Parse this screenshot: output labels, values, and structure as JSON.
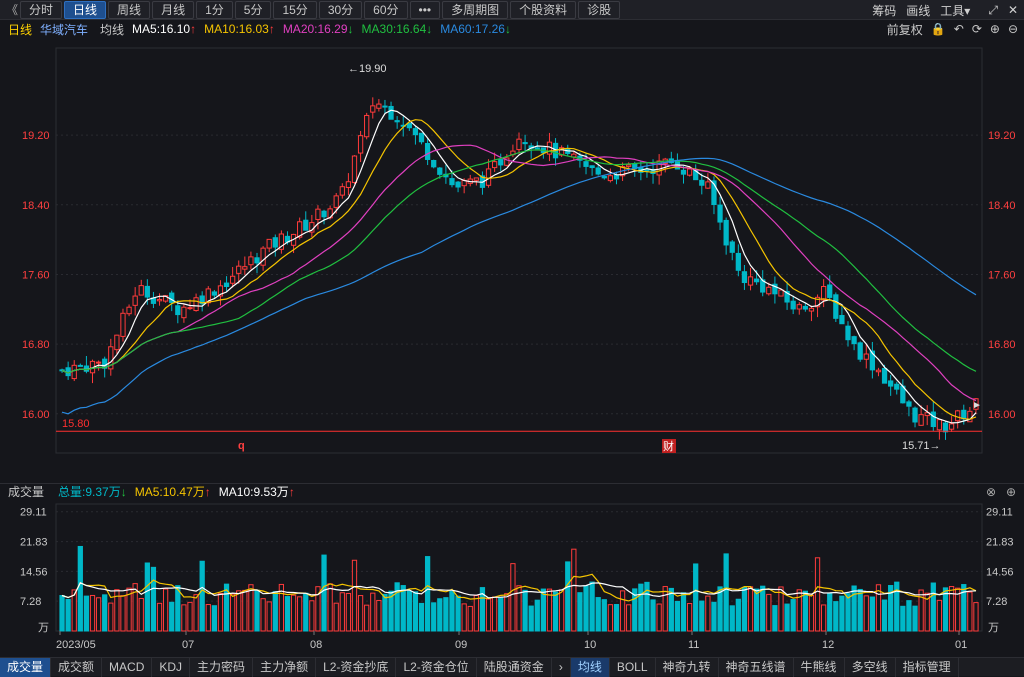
{
  "toolbar": {
    "tabs": [
      "分时",
      "日线",
      "周线",
      "月线",
      "1分",
      "5分",
      "15分",
      "30分",
      "60分",
      "•••",
      "多周期图",
      "个股资料",
      "诊股"
    ],
    "active": 1,
    "right": [
      "筹码",
      "画线",
      "工具"
    ]
  },
  "header": {
    "period": "日线",
    "stock_name": "华域汽车",
    "avg_label": "均线",
    "ma5": "MA5:16.10",
    "ma10": "MA10:16.03",
    "ma20": "MA20:16.29",
    "ma30": "MA30:16.64",
    "ma60": "MA60:17.26",
    "adjust": "前复权"
  },
  "colors": {
    "up": "#ff3b3b",
    "down": "#00b8c8",
    "ma5": "#ffffff",
    "ma10": "#f5c400",
    "ma20": "#e040c0",
    "ma30": "#20c040",
    "ma60": "#2a8ae0",
    "price_axis": "#ff4040",
    "support": "#ff3030"
  },
  "price_axis": {
    "ticks": [
      "19.20",
      "18.40",
      "17.60",
      "16.80",
      "16.00"
    ],
    "values": [
      19.2,
      18.4,
      17.6,
      16.8,
      16.0
    ]
  },
  "annotations": {
    "high": "19.90",
    "low": "15.71",
    "support_label": "15.80",
    "support_value": 15.8,
    "markers": [
      "q",
      "财"
    ]
  },
  "volume": {
    "title": "成交量",
    "total": "总量:9.37万",
    "ma5": "MA5:10.47万",
    "ma10": "MA10:9.53万",
    "ticks": [
      "29.11",
      "21.83",
      "14.56",
      "7.28"
    ],
    "tick_values": [
      29.11,
      21.83,
      14.56,
      7.28
    ],
    "unit": "万"
  },
  "x_axis": {
    "labels": [
      "2023/05",
      "07",
      "08",
      "09",
      "10",
      "11",
      "12",
      "01"
    ]
  },
  "chart_data": {
    "type": "candlestick",
    "ylim": [
      15.55,
      20.2
    ],
    "candle_count": 151,
    "high": 19.9,
    "low": 15.71,
    "last_close": 16.1,
    "ma_last": {
      "MA5": 16.1,
      "MA10": 16.03,
      "MA20": 16.29,
      "MA30": 16.64,
      "MA60": 17.26
    }
  },
  "bottom_tabs": [
    "成交量",
    "成交额",
    "MACD",
    "KDJ",
    "主力密码",
    "主力净额",
    "L2-资金抄底",
    "L2-资金仓位",
    "陆股通资金",
    "›",
    "均线",
    "BOLL",
    "神奇九转",
    "神奇五线谱",
    "牛熊线",
    "多空线",
    "指标管理"
  ]
}
